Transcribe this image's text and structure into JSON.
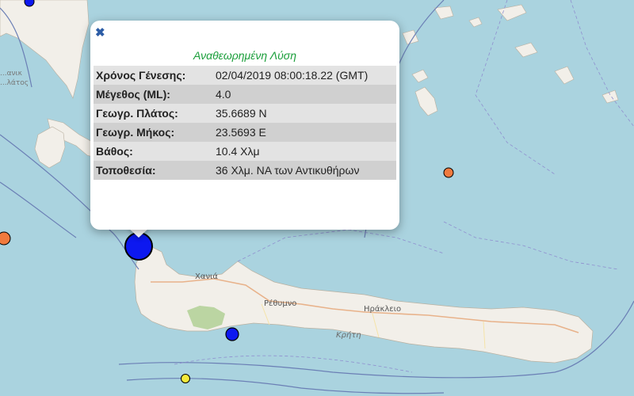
{
  "map": {
    "labels": {
      "chania": "Χανιά",
      "rethymno": "Ρέθυμνο",
      "heraklion": "Ηράκλειο",
      "crete": "Κρήτη",
      "edge_top": "...ανικ",
      "edge_bottom": "...λάτος"
    },
    "colors": {
      "sea": "#aad3df",
      "land": "#f2efe9",
      "forest": "#b5d29a",
      "fault_line": "#6b7fb5",
      "roads": "#e8b28a",
      "marker_blue": "#0d18f0",
      "marker_orange": "#f07a3e",
      "marker_yellow": "#f4ea3a"
    }
  },
  "popup": {
    "close_icon": "close-icon",
    "title": "Αναθεωρημένη Λύση",
    "rows": [
      {
        "label": "Χρόνος Γένεσης:",
        "value": "02/04/2019 08:00:18.22 (GMT)"
      },
      {
        "label": "Μέγεθος (ML):",
        "value": "4.0"
      },
      {
        "label": "Γεωγρ. Πλάτος:",
        "value": "35.6689 N"
      },
      {
        "label": "Γεωγρ. Μήκος:",
        "value": "23.5693 E"
      },
      {
        "label": "Βάθος:",
        "value": "10.4 Χλμ"
      },
      {
        "label": "Τοποθεσία:",
        "value": "36 Χλμ. ΝΑ των Αντικυθήρων"
      }
    ]
  }
}
